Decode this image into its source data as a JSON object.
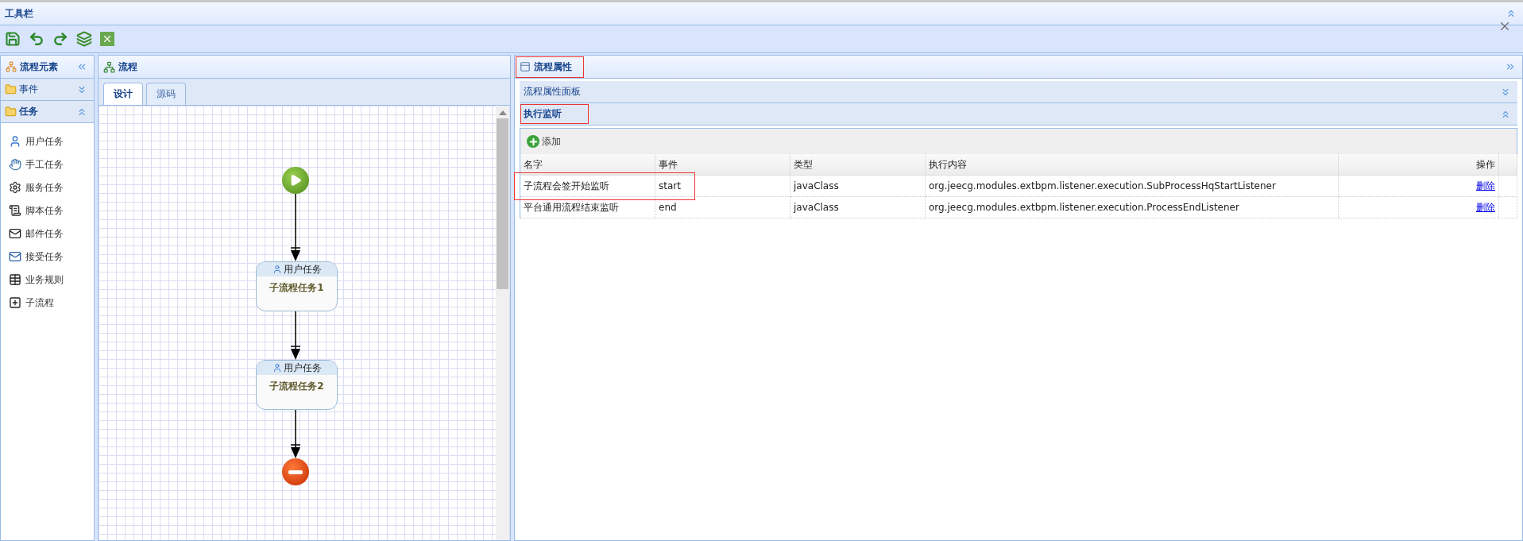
{
  "toolbar": {
    "title": "工具栏"
  },
  "elements_panel": {
    "title": "流程元素",
    "groups": [
      {
        "label": "事件",
        "expanded": false
      },
      {
        "label": "任务",
        "expanded": true,
        "items": [
          "用户任务",
          "手工任务",
          "服务任务",
          "脚本任务",
          "邮件任务",
          "接受任务",
          "业务规则",
          "子流程"
        ]
      }
    ]
  },
  "flow_panel": {
    "title": "流程",
    "tabs": [
      {
        "label": "设计",
        "selected": true
      },
      {
        "label": "源码",
        "selected": false
      }
    ],
    "nodes": [
      {
        "kind": "start"
      },
      {
        "kind": "task",
        "type": "用户任务",
        "name": "子流程任务1"
      },
      {
        "kind": "task",
        "type": "用户任务",
        "name": "子流程任务2"
      },
      {
        "kind": "end"
      }
    ]
  },
  "properties_panel": {
    "title": "流程属性",
    "highlighted": true,
    "sections": [
      {
        "label": "流程属性面板",
        "expanded": false,
        "highlighted": false
      },
      {
        "label": "执行监听",
        "expanded": true,
        "highlighted": true
      }
    ],
    "add_button": "添加",
    "table": {
      "columns": [
        "名字",
        "事件",
        "类型",
        "执行内容",
        "操作"
      ],
      "rows": [
        {
          "cells": [
            "子流程会签开始监听",
            "start",
            "javaClass",
            "org.jeecg.modules.extbpm.listener.execution.SubProcessHqStartListener"
          ],
          "action": "删除",
          "highlighted": true
        },
        {
          "cells": [
            "平台通用流程结束监听",
            "end",
            "javaClass",
            "org.jeecg.modules.extbpm.listener.execution.ProcessEndListener"
          ],
          "action": "删除",
          "highlighted": false
        }
      ]
    }
  }
}
